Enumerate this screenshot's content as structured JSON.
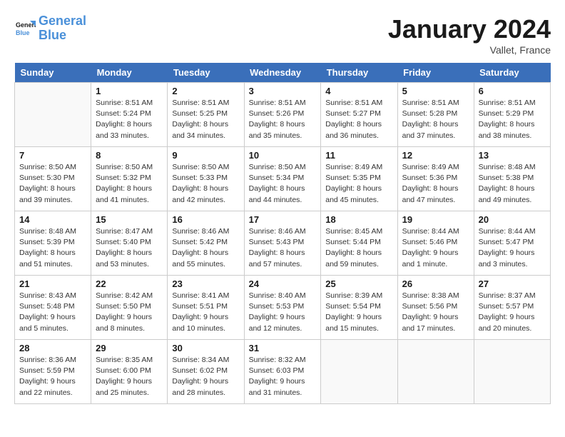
{
  "logo": {
    "line1": "General",
    "line2": "Blue"
  },
  "title": "January 2024",
  "subtitle": "Vallet, France",
  "days_of_week": [
    "Sunday",
    "Monday",
    "Tuesday",
    "Wednesday",
    "Thursday",
    "Friday",
    "Saturday"
  ],
  "weeks": [
    [
      {
        "num": "",
        "sunrise": "",
        "sunset": "",
        "daylight": ""
      },
      {
        "num": "1",
        "sunrise": "Sunrise: 8:51 AM",
        "sunset": "Sunset: 5:24 PM",
        "daylight": "Daylight: 8 hours and 33 minutes."
      },
      {
        "num": "2",
        "sunrise": "Sunrise: 8:51 AM",
        "sunset": "Sunset: 5:25 PM",
        "daylight": "Daylight: 8 hours and 34 minutes."
      },
      {
        "num": "3",
        "sunrise": "Sunrise: 8:51 AM",
        "sunset": "Sunset: 5:26 PM",
        "daylight": "Daylight: 8 hours and 35 minutes."
      },
      {
        "num": "4",
        "sunrise": "Sunrise: 8:51 AM",
        "sunset": "Sunset: 5:27 PM",
        "daylight": "Daylight: 8 hours and 36 minutes."
      },
      {
        "num": "5",
        "sunrise": "Sunrise: 8:51 AM",
        "sunset": "Sunset: 5:28 PM",
        "daylight": "Daylight: 8 hours and 37 minutes."
      },
      {
        "num": "6",
        "sunrise": "Sunrise: 8:51 AM",
        "sunset": "Sunset: 5:29 PM",
        "daylight": "Daylight: 8 hours and 38 minutes."
      }
    ],
    [
      {
        "num": "7",
        "sunrise": "Sunrise: 8:50 AM",
        "sunset": "Sunset: 5:30 PM",
        "daylight": "Daylight: 8 hours and 39 minutes."
      },
      {
        "num": "8",
        "sunrise": "Sunrise: 8:50 AM",
        "sunset": "Sunset: 5:32 PM",
        "daylight": "Daylight: 8 hours and 41 minutes."
      },
      {
        "num": "9",
        "sunrise": "Sunrise: 8:50 AM",
        "sunset": "Sunset: 5:33 PM",
        "daylight": "Daylight: 8 hours and 42 minutes."
      },
      {
        "num": "10",
        "sunrise": "Sunrise: 8:50 AM",
        "sunset": "Sunset: 5:34 PM",
        "daylight": "Daylight: 8 hours and 44 minutes."
      },
      {
        "num": "11",
        "sunrise": "Sunrise: 8:49 AM",
        "sunset": "Sunset: 5:35 PM",
        "daylight": "Daylight: 8 hours and 45 minutes."
      },
      {
        "num": "12",
        "sunrise": "Sunrise: 8:49 AM",
        "sunset": "Sunset: 5:36 PM",
        "daylight": "Daylight: 8 hours and 47 minutes."
      },
      {
        "num": "13",
        "sunrise": "Sunrise: 8:48 AM",
        "sunset": "Sunset: 5:38 PM",
        "daylight": "Daylight: 8 hours and 49 minutes."
      }
    ],
    [
      {
        "num": "14",
        "sunrise": "Sunrise: 8:48 AM",
        "sunset": "Sunset: 5:39 PM",
        "daylight": "Daylight: 8 hours and 51 minutes."
      },
      {
        "num": "15",
        "sunrise": "Sunrise: 8:47 AM",
        "sunset": "Sunset: 5:40 PM",
        "daylight": "Daylight: 8 hours and 53 minutes."
      },
      {
        "num": "16",
        "sunrise": "Sunrise: 8:46 AM",
        "sunset": "Sunset: 5:42 PM",
        "daylight": "Daylight: 8 hours and 55 minutes."
      },
      {
        "num": "17",
        "sunrise": "Sunrise: 8:46 AM",
        "sunset": "Sunset: 5:43 PM",
        "daylight": "Daylight: 8 hours and 57 minutes."
      },
      {
        "num": "18",
        "sunrise": "Sunrise: 8:45 AM",
        "sunset": "Sunset: 5:44 PM",
        "daylight": "Daylight: 8 hours and 59 minutes."
      },
      {
        "num": "19",
        "sunrise": "Sunrise: 8:44 AM",
        "sunset": "Sunset: 5:46 PM",
        "daylight": "Daylight: 9 hours and 1 minute."
      },
      {
        "num": "20",
        "sunrise": "Sunrise: 8:44 AM",
        "sunset": "Sunset: 5:47 PM",
        "daylight": "Daylight: 9 hours and 3 minutes."
      }
    ],
    [
      {
        "num": "21",
        "sunrise": "Sunrise: 8:43 AM",
        "sunset": "Sunset: 5:48 PM",
        "daylight": "Daylight: 9 hours and 5 minutes."
      },
      {
        "num": "22",
        "sunrise": "Sunrise: 8:42 AM",
        "sunset": "Sunset: 5:50 PM",
        "daylight": "Daylight: 9 hours and 8 minutes."
      },
      {
        "num": "23",
        "sunrise": "Sunrise: 8:41 AM",
        "sunset": "Sunset: 5:51 PM",
        "daylight": "Daylight: 9 hours and 10 minutes."
      },
      {
        "num": "24",
        "sunrise": "Sunrise: 8:40 AM",
        "sunset": "Sunset: 5:53 PM",
        "daylight": "Daylight: 9 hours and 12 minutes."
      },
      {
        "num": "25",
        "sunrise": "Sunrise: 8:39 AM",
        "sunset": "Sunset: 5:54 PM",
        "daylight": "Daylight: 9 hours and 15 minutes."
      },
      {
        "num": "26",
        "sunrise": "Sunrise: 8:38 AM",
        "sunset": "Sunset: 5:56 PM",
        "daylight": "Daylight: 9 hours and 17 minutes."
      },
      {
        "num": "27",
        "sunrise": "Sunrise: 8:37 AM",
        "sunset": "Sunset: 5:57 PM",
        "daylight": "Daylight: 9 hours and 20 minutes."
      }
    ],
    [
      {
        "num": "28",
        "sunrise": "Sunrise: 8:36 AM",
        "sunset": "Sunset: 5:59 PM",
        "daylight": "Daylight: 9 hours and 22 minutes."
      },
      {
        "num": "29",
        "sunrise": "Sunrise: 8:35 AM",
        "sunset": "Sunset: 6:00 PM",
        "daylight": "Daylight: 9 hours and 25 minutes."
      },
      {
        "num": "30",
        "sunrise": "Sunrise: 8:34 AM",
        "sunset": "Sunset: 6:02 PM",
        "daylight": "Daylight: 9 hours and 28 minutes."
      },
      {
        "num": "31",
        "sunrise": "Sunrise: 8:32 AM",
        "sunset": "Sunset: 6:03 PM",
        "daylight": "Daylight: 9 hours and 31 minutes."
      },
      {
        "num": "",
        "sunrise": "",
        "sunset": "",
        "daylight": ""
      },
      {
        "num": "",
        "sunrise": "",
        "sunset": "",
        "daylight": ""
      },
      {
        "num": "",
        "sunrise": "",
        "sunset": "",
        "daylight": ""
      }
    ]
  ]
}
